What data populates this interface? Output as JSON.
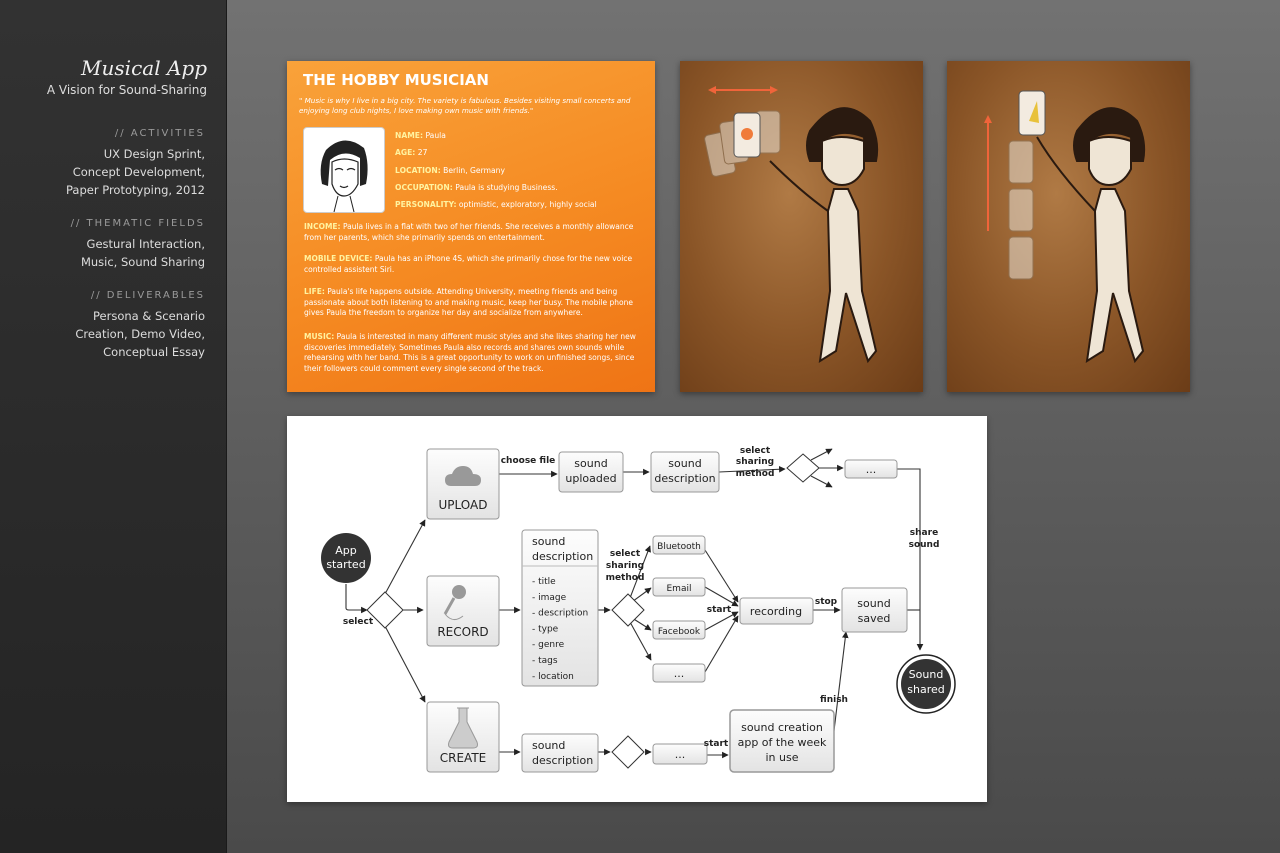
{
  "sidebar": {
    "title": "Musical App",
    "subtitle": "A Vision for Sound-Sharing",
    "sections": [
      {
        "heading": "// ACTIVITIES",
        "lines": [
          "UX Design Sprint,",
          "Concept Development,",
          "Paper Prototyping, 2012"
        ]
      },
      {
        "heading": "// THEMATIC FIELDS",
        "lines": [
          "Gestural Interaction,",
          "Music, Sound Sharing"
        ]
      },
      {
        "heading": "// DELIVERABLES",
        "lines": [
          "Persona & Scenario",
          "Creation, Demo Video,",
          "Conceptual Essay"
        ]
      }
    ]
  },
  "persona": {
    "title": "THE HOBBY MUSICIAN",
    "quote": "\" Music is why I live in a big city. The variety is fabulous. Besides visiting small concerts and enjoying long club nights, I love making own music with friends.\"",
    "facts": [
      {
        "label": "NAME:",
        "value": "Paula"
      },
      {
        "label": "AGE:",
        "value": "27"
      },
      {
        "label": "LOCATION:",
        "value": "Berlin, Germany"
      },
      {
        "label": "OCCUPATION:",
        "value": "Paula is studying Business."
      },
      {
        "label": "PERSONALITY:",
        "value": "optimistic, exploratory, highly social"
      }
    ],
    "paragraphs": [
      {
        "label": "INCOME:",
        "text": "Paula lives in a flat with two of her friends. She receives a monthly allowance from her parents, which she primarily spends on entertainment."
      },
      {
        "label": "MOBILE DEVICE:",
        "text": "Paula has an iPhone 4S, which she primarily chose for the new voice controlled assistent Siri."
      },
      {
        "label": "LIFE:",
        "text": "Paula's life happens outside. Attending University, meeting friends and being passionate about both listening to and making music, keep her busy. The mobile phone gives Paula the freedom to organize her day and socialize from anywhere."
      },
      {
        "label": "MUSIC:",
        "text": "Paula is interested in many different music styles and she likes sharing her new discoveries immediately. Sometimes Paula also records and shares own sounds while rehearsing with her band. This is a great opportunity to work on unfinished songs, since their followers could comment every single second of the track."
      }
    ]
  },
  "photos": [
    {
      "name": "paper-prototype-swipe-horizontal",
      "gesture": "horizontal"
    },
    {
      "name": "paper-prototype-swipe-vertical",
      "gesture": "vertical"
    }
  ],
  "flow": {
    "start": [
      "App",
      "started"
    ],
    "select": "select",
    "upload": "UPLOAD",
    "record": "RECORD",
    "create": "CREATE",
    "choose_file": "choose file",
    "sound_uploaded": [
      "sound",
      "uploaded"
    ],
    "sound_description": [
      "sound",
      "description"
    ],
    "select_sharing_method": [
      "select",
      "sharing",
      "method"
    ],
    "ellipsis": "...",
    "share_sound": [
      "share",
      "sound"
    ],
    "desc_items": [
      "title",
      "image",
      "description",
      "type",
      "genre",
      "tags",
      "location"
    ],
    "share_options": [
      "Bluetooth",
      "Email",
      "Facebook",
      "..."
    ],
    "start_label": "start",
    "recording": "recording",
    "stop": "stop",
    "sound_saved": [
      "sound",
      "saved"
    ],
    "sound_shared": [
      "Sound",
      "shared"
    ],
    "finish": "finish",
    "sound_creation": [
      "sound creation",
      "app of the week",
      "in use"
    ]
  }
}
